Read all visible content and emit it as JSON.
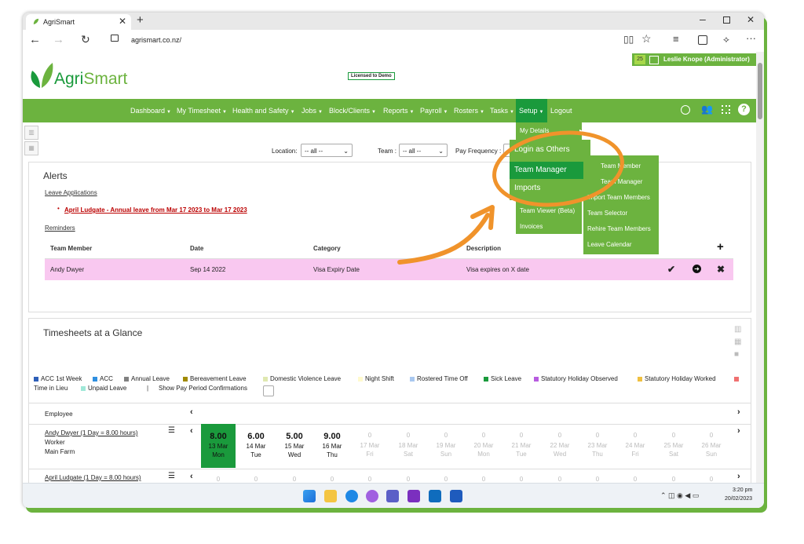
{
  "browser": {
    "tab_title": "AgriSmart",
    "url": "agrismart.co.nz/"
  },
  "header": {
    "logo_text_1": "Agri",
    "logo_text_2": "Smart",
    "licensed": "Licensed to Demo",
    "badge_count": "25",
    "user": "Leslie Knope (Administrator)"
  },
  "nav": {
    "items": [
      "Dashboard",
      "My Timesheet",
      "Health and Safety",
      "Jobs",
      "Block/Clients",
      "Reports",
      "Payroll",
      "Rosters",
      "Tasks",
      "Setup",
      "Logout"
    ]
  },
  "filters": {
    "location_label": "Location:",
    "location_value": "-- all --",
    "team_label": "Team :",
    "team_value": "-- all --",
    "pay_label": "Pay Frequency :",
    "pay_value": "Al"
  },
  "setup_menu": {
    "my_details": "My Details",
    "login_as_others": "Login as Others",
    "team_manager": "Team Manager",
    "imports": "Imports",
    "team_viewer": "Team Viewer (Beta)",
    "invoices": "Invoices"
  },
  "team_submenu": {
    "items": [
      "Team Member",
      "Team Manager",
      "Import Team Members",
      "Team Selector",
      "Rehire Team Members",
      "Leave Calendar"
    ]
  },
  "alerts": {
    "title": "Alerts",
    "leave_applications": "Leave Applications",
    "leave_item": "April Ludgate - Annual leave from Mar 17 2023 to Mar 17 2023",
    "reminders": "Reminders",
    "columns": [
      "Team Member",
      "Date",
      "Category",
      "Description"
    ],
    "row": {
      "member": "Andy Dwyer",
      "date": "Sep 14 2022",
      "category": "Visa Expiry Date",
      "description": "Visa expires on X date"
    }
  },
  "glance": {
    "title": "Timesheets at a Glance",
    "legend": [
      {
        "label": "ACC 1st Week",
        "color": "#2e5fb8"
      },
      {
        "label": "ACC",
        "color": "#2f8fe0"
      },
      {
        "label": "Annual Leave",
        "color": "#808080"
      },
      {
        "label": "Bereavement Leave",
        "color": "#a08a00"
      },
      {
        "label": "Domestic Violence Leave",
        "color": "#dfe8b0"
      },
      {
        "label": "Night Shift",
        "color": "#fffacd"
      },
      {
        "label": "Rostered Time Off",
        "color": "#a9c8f0"
      },
      {
        "label": "Sick Leave",
        "color": "#1a9a3c"
      },
      {
        "label": "Statutory Holiday Observed",
        "color": "#b85ce0"
      },
      {
        "label": "Statutory Holiday Worked",
        "color": "#f0c040"
      },
      {
        "label": "",
        "color": "#f07070"
      }
    ],
    "legend2": [
      {
        "label": "Time in Lieu",
        "color": null
      },
      {
        "label": "Unpaid Leave",
        "color": "#a0e8d8"
      }
    ],
    "show_pay_period": "Show Pay Period Confirmations",
    "employee_header": "Employee",
    "employees": [
      {
        "name": "Andy Dwyer (1 Day = 8.00 hours)",
        "role": "Worker",
        "location": "Main Farm"
      },
      {
        "name": "April Ludgate (1 Day = 8.00 hours)",
        "role": "",
        "location": ""
      }
    ],
    "days": [
      {
        "hours": "8.00",
        "date": "13 Mar",
        "dow": "Mon",
        "state": "active"
      },
      {
        "hours": "6.00",
        "date": "14 Mar",
        "dow": "Tue",
        "state": "filled"
      },
      {
        "hours": "5.00",
        "date": "15 Mar",
        "dow": "Wed",
        "state": "filled"
      },
      {
        "hours": "9.00",
        "date": "16 Mar",
        "dow": "Thu",
        "state": "filled"
      },
      {
        "hours": "0",
        "date": "17 Mar",
        "dow": "Fri",
        "state": "empty"
      },
      {
        "hours": "0",
        "date": "18 Mar",
        "dow": "Sat",
        "state": "empty"
      },
      {
        "hours": "0",
        "date": "19 Mar",
        "dow": "Sun",
        "state": "empty"
      },
      {
        "hours": "0",
        "date": "20 Mar",
        "dow": "Mon",
        "state": "empty"
      },
      {
        "hours": "0",
        "date": "21 Mar",
        "dow": "Tue",
        "state": "empty"
      },
      {
        "hours": "0",
        "date": "22 Mar",
        "dow": "Wed",
        "state": "empty"
      },
      {
        "hours": "0",
        "date": "23 Mar",
        "dow": "Thu",
        "state": "empty"
      },
      {
        "hours": "0",
        "date": "24 Mar",
        "dow": "Fri",
        "state": "empty"
      },
      {
        "hours": "0",
        "date": "25 Mar",
        "dow": "Sat",
        "state": "empty"
      },
      {
        "hours": "0",
        "date": "26 Mar",
        "dow": "Sun",
        "state": "empty"
      }
    ],
    "row2_hours": "0"
  },
  "taskbar": {
    "time": "3:20 pm",
    "date": "20/02/2023"
  },
  "colors": {
    "brand_green": "#6cb33f",
    "dark_green": "#1a9a3c",
    "highlight_orange": "#f0932b",
    "reminder_row": "#f9c8f0"
  }
}
